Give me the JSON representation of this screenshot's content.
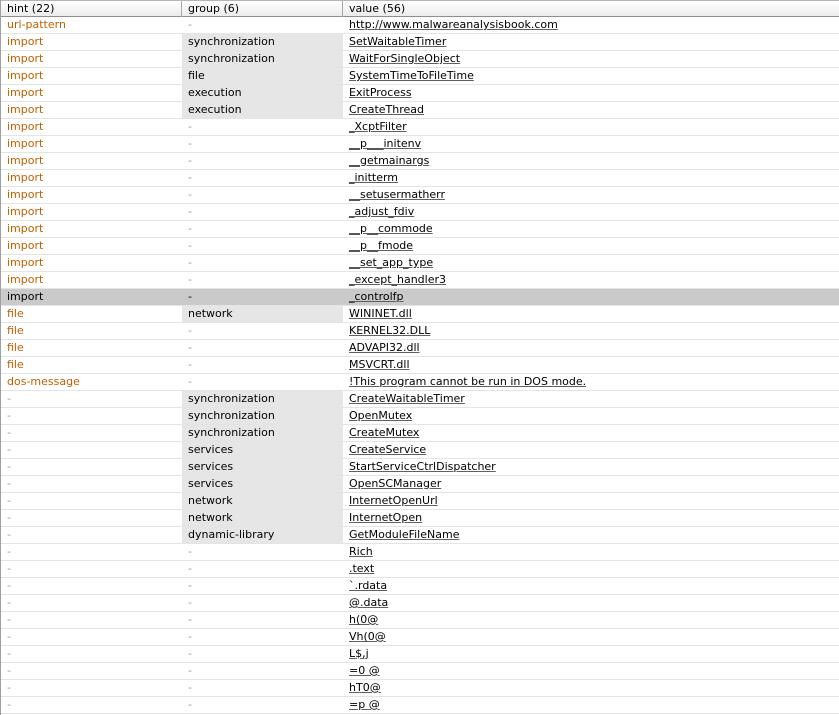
{
  "colors": {
    "flag_hint": "#c06000",
    "dash": "#9a9a9a",
    "group_fill": "#e6e6e6",
    "selected_row": "#cacaca"
  },
  "header": {
    "hint": "hint (22)",
    "group": "group (6)",
    "value": "value (56)"
  },
  "selected_index": 16,
  "rows": [
    {
      "hint": "url-pattern",
      "group": "-",
      "value": "http://www.malwareanalysisbook.com"
    },
    {
      "hint": "import",
      "group": "synchronization",
      "value": "SetWaitableTimer"
    },
    {
      "hint": "import",
      "group": "synchronization",
      "value": "WaitForSingleObject"
    },
    {
      "hint": "import",
      "group": "file",
      "value": "SystemTimeToFileTime"
    },
    {
      "hint": "import",
      "group": "execution",
      "value": "ExitProcess"
    },
    {
      "hint": "import",
      "group": "execution",
      "value": "CreateThread"
    },
    {
      "hint": "import",
      "group": "-",
      "value": "_XcptFilter"
    },
    {
      "hint": "import",
      "group": "-",
      "value": "__p___initenv"
    },
    {
      "hint": "import",
      "group": "-",
      "value": "__getmainargs"
    },
    {
      "hint": "import",
      "group": "-",
      "value": "_initterm"
    },
    {
      "hint": "import",
      "group": "-",
      "value": "__setusermatherr"
    },
    {
      "hint": "import",
      "group": "-",
      "value": "_adjust_fdiv"
    },
    {
      "hint": "import",
      "group": "-",
      "value": "__p__commode"
    },
    {
      "hint": "import",
      "group": "-",
      "value": "__p__fmode"
    },
    {
      "hint": "import",
      "group": "-",
      "value": "__set_app_type"
    },
    {
      "hint": "import",
      "group": "-",
      "value": "_except_handler3"
    },
    {
      "hint": "import",
      "group": "-",
      "value": "_controlfp"
    },
    {
      "hint": "file",
      "group": "network",
      "value": "WININET.dll"
    },
    {
      "hint": "file",
      "group": "-",
      "value": "KERNEL32.DLL"
    },
    {
      "hint": "file",
      "group": "-",
      "value": "ADVAPI32.dll"
    },
    {
      "hint": "file",
      "group": "-",
      "value": "MSVCRT.dll"
    },
    {
      "hint": "dos-message",
      "group": "-",
      "value": "!This program cannot be run in DOS mode."
    },
    {
      "hint": "-",
      "group": "synchronization",
      "value": "CreateWaitableTimer"
    },
    {
      "hint": "-",
      "group": "synchronization",
      "value": "OpenMutex"
    },
    {
      "hint": "-",
      "group": "synchronization",
      "value": "CreateMutex"
    },
    {
      "hint": "-",
      "group": "services",
      "value": "CreateService"
    },
    {
      "hint": "-",
      "group": "services",
      "value": "StartServiceCtrlDispatcher"
    },
    {
      "hint": "-",
      "group": "services",
      "value": "OpenSCManager"
    },
    {
      "hint": "-",
      "group": "network",
      "value": "InternetOpenUrl"
    },
    {
      "hint": "-",
      "group": "network",
      "value": "InternetOpen"
    },
    {
      "hint": "-",
      "group": "dynamic-library",
      "value": "GetModuleFileName"
    },
    {
      "hint": "-",
      "group": "-",
      "value": "Rich"
    },
    {
      "hint": "-",
      "group": "-",
      "value": ".text"
    },
    {
      "hint": "-",
      "group": "-",
      "value": "`.rdata"
    },
    {
      "hint": "-",
      "group": "-",
      "value": "@.data"
    },
    {
      "hint": "-",
      "group": "-",
      "value": "h(0@"
    },
    {
      "hint": "-",
      "group": "-",
      "value": "Vh(0@"
    },
    {
      "hint": "-",
      "group": "-",
      "value": "L$,j"
    },
    {
      "hint": "-",
      "group": "-",
      "value": "=0 @"
    },
    {
      "hint": "-",
      "group": "-",
      "value": "hT0@"
    },
    {
      "hint": "-",
      "group": "-",
      "value": "=p @"
    }
  ]
}
